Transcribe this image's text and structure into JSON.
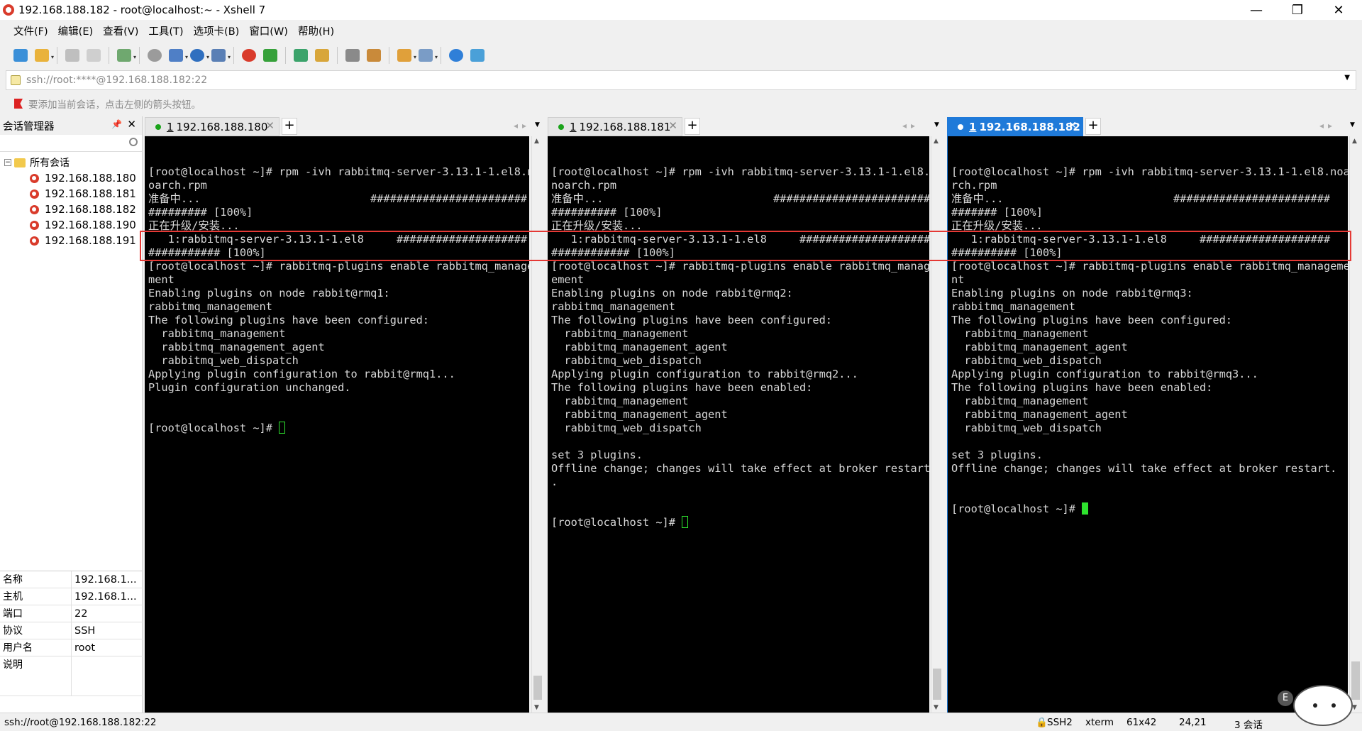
{
  "window": {
    "title": "192.168.188.182 - root@localhost:~ - Xshell 7",
    "controls": [
      "minimize-icon",
      "restore-icon",
      "close-icon"
    ]
  },
  "menu": [
    "文件(F)",
    "编辑(E)",
    "查看(V)",
    "工具(T)",
    "选项卡(B)",
    "窗口(W)",
    "帮助(H)"
  ],
  "address": {
    "value": "ssh://root:****@192.168.188.182:22"
  },
  "hint": "要添加当前会话，点击左侧的箭头按钮。",
  "sidebar": {
    "title": "会话管理器",
    "tree_root": "所有会话",
    "sessions": [
      "192.168.188.180",
      "192.168.188.181",
      "192.168.188.182",
      "192.168.188.190",
      "192.168.188.191"
    ]
  },
  "properties": [
    {
      "key": "名称",
      "value": "192.168.1..."
    },
    {
      "key": "主机",
      "value": "192.168.1..."
    },
    {
      "key": "端口",
      "value": "22"
    },
    {
      "key": "协议",
      "value": "SSH"
    },
    {
      "key": "用户名",
      "value": "root"
    },
    {
      "key": "说明",
      "value": ""
    }
  ],
  "panes": [
    {
      "tab": {
        "num": "1",
        "host": "192.168.188.180"
      },
      "lines": [
        "[root@localhost ~]# rpm -ivh rabbitmq-server-3.13.1-1.el8.n",
        "oarch.rpm",
        "准备中...                          ########################",
        "######### [100%]",
        "正在升级/安装...",
        "   1:rabbitmq-server-3.13.1-1.el8     ####################",
        "########### [100%]",
        "[root@localhost ~]# rabbitmq-plugins enable rabbitmq_manage",
        "ment",
        "Enabling plugins on node rabbit@rmq1:",
        "rabbitmq_management",
        "The following plugins have been configured:",
        "  rabbitmq_management",
        "  rabbitmq_management_agent",
        "  rabbitmq_web_dispatch",
        "Applying plugin configuration to rabbit@rmq1...",
        "Plugin configuration unchanged."
      ],
      "prompt": "[root@localhost ~]# "
    },
    {
      "tab": {
        "num": "1",
        "host": "192.168.188.181"
      },
      "lines": [
        "[root@localhost ~]# rpm -ivh rabbitmq-server-3.13.1-1.el8.",
        "noarch.rpm",
        "准备中...                          ########################",
        "########## [100%]",
        "正在升级/安装...",
        "   1:rabbitmq-server-3.13.1-1.el8     ####################",
        "############ [100%]",
        "[root@localhost ~]# rabbitmq-plugins enable rabbitmq_manag",
        "ement",
        "Enabling plugins on node rabbit@rmq2:",
        "rabbitmq_management",
        "The following plugins have been configured:",
        "  rabbitmq_management",
        "  rabbitmq_management_agent",
        "  rabbitmq_web_dispatch",
        "Applying plugin configuration to rabbit@rmq2...",
        "The following plugins have been enabled:",
        "  rabbitmq_management",
        "  rabbitmq_management_agent",
        "  rabbitmq_web_dispatch",
        "",
        "set 3 plugins.",
        "Offline change; changes will take effect at broker restart",
        "."
      ],
      "prompt": "[root@localhost ~]# "
    },
    {
      "tab": {
        "num": "1",
        "host": "192.168.188.182"
      },
      "lines": [
        "[root@localhost ~]# rpm -ivh rabbitmq-server-3.13.1-1.el8.noa",
        "rch.rpm",
        "准备中...                          ########################",
        "####### [100%]",
        "正在升级/安装...",
        "   1:rabbitmq-server-3.13.1-1.el8     ####################",
        "########## [100%]",
        "[root@localhost ~]# rabbitmq-plugins enable rabbitmq_manageme",
        "nt",
        "Enabling plugins on node rabbit@rmq3:",
        "rabbitmq_management",
        "The following plugins have been configured:",
        "  rabbitmq_management",
        "  rabbitmq_management_agent",
        "  rabbitmq_web_dispatch",
        "Applying plugin configuration to rabbit@rmq3...",
        "The following plugins have been enabled:",
        "  rabbitmq_management",
        "  rabbitmq_management_agent",
        "  rabbitmq_web_dispatch",
        "",
        "set 3 plugins.",
        "Offline change; changes will take effect at broker restart."
      ],
      "prompt": "[root@localhost ~]# "
    }
  ],
  "status": {
    "url": "ssh://root@192.168.188.182:22",
    "proto": "SSH2",
    "term": "xterm",
    "size": "61x42",
    "pos": "24,21",
    "sessions": "3 会话"
  },
  "colors": {
    "accent": "#1f7ad9",
    "cursor": "#2ee32e",
    "highlight": "#e53935"
  }
}
